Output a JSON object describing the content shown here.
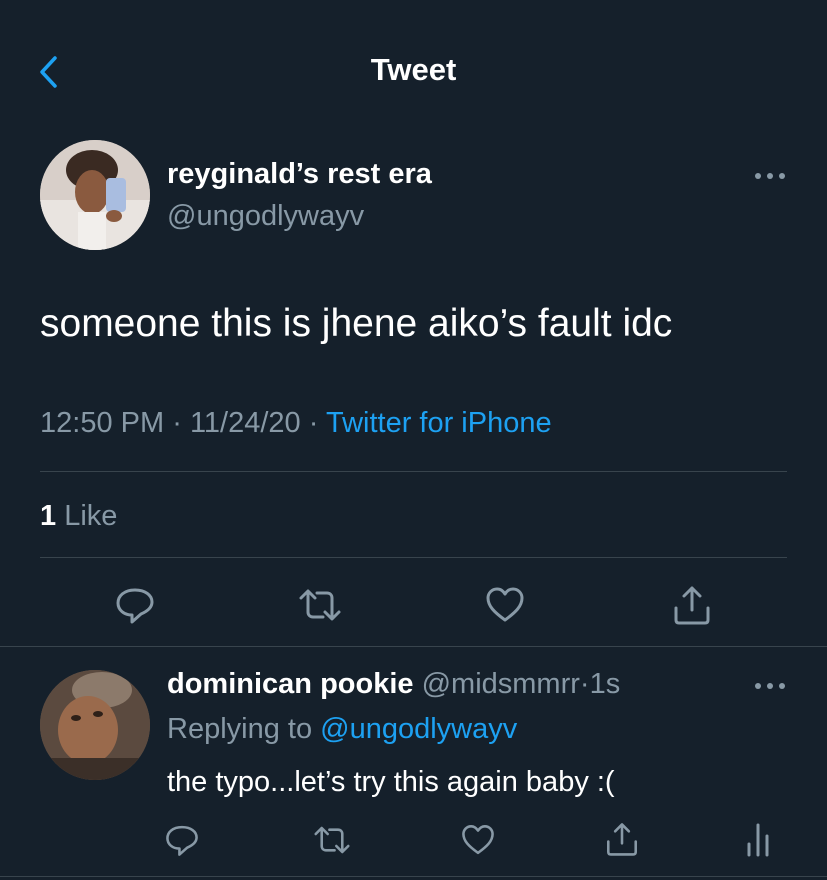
{
  "header": {
    "title": "Tweet",
    "back_icon": "chevron-left-icon"
  },
  "tweet": {
    "display_name": "reyginald’s rest era",
    "handle": "@ungodlywayv",
    "text": "someone this is jhene aiko’s fault idc",
    "time": "12:50 PM",
    "date": "11/24/20",
    "separator": "·",
    "source": "Twitter for iPhone",
    "likes_count": "1",
    "likes_label": "Like"
  },
  "reply": {
    "display_name": "dominican pookie",
    "handle": "@midsmmrr",
    "separator": "·",
    "age": "1s",
    "replying_prefix": "Replying to",
    "replying_to": "@ungodlywayv",
    "text": "the typo...let’s try this again baby :("
  },
  "colors": {
    "background": "#15202b",
    "accent": "#1da1f2",
    "muted": "#8899a6",
    "divider": "#38444d"
  }
}
